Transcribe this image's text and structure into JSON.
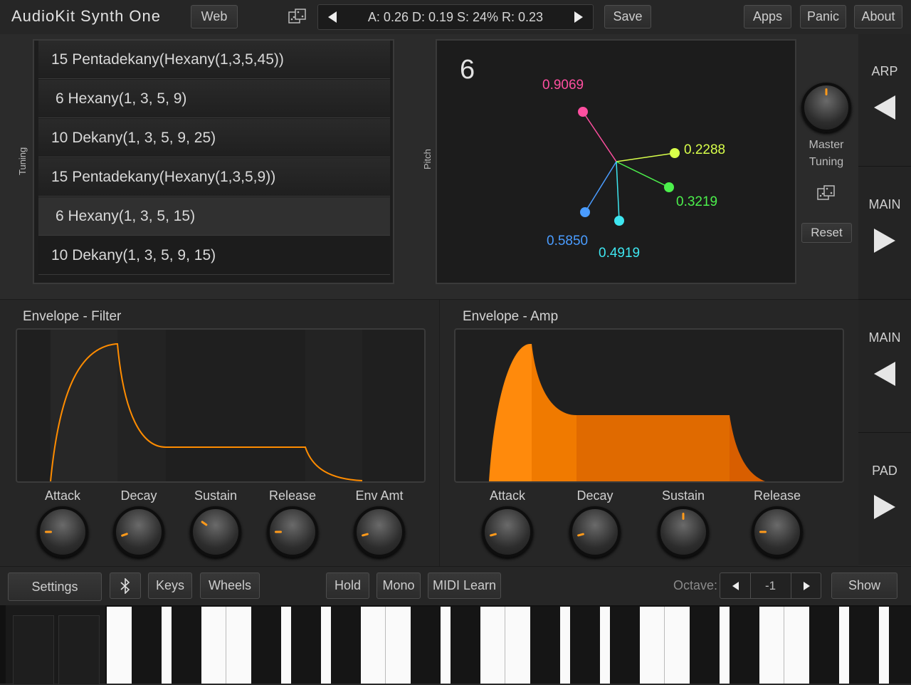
{
  "header": {
    "app_title": "AudioKit Synth One",
    "web_label": "Web",
    "dice_icon": "dice-icon",
    "preset_text": "A: 0.26 D: 0.19 S: 24% R: 0.23",
    "save_label": "Save",
    "apps_label": "Apps",
    "panic_label": "Panic",
    "about_label": "About"
  },
  "tuning_list": {
    "side_label": "Tuning",
    "items": [
      "15 Pentadekany(Hexany(1,3,5,45))",
      "6 Hexany(1, 3, 5, 9)",
      "10 Dekany(1, 3, 5, 9, 25)",
      "15 Pentadekany(Hexany(1,3,5,9))",
      "6 Hexany(1, 3, 5, 15)",
      "10 Dekany(1, 3, 5, 9, 15)"
    ],
    "selected_index": 4
  },
  "tuning_display": {
    "side_label": "Pitch",
    "count": "6",
    "values": [
      {
        "label": "0.9069",
        "color": "#ff4fa0"
      },
      {
        "label": "0.2288",
        "color": "#d8ff4a"
      },
      {
        "label": "0.3219",
        "color": "#4cf04c"
      },
      {
        "label": "0.5850",
        "color": "#4a9cff"
      },
      {
        "label": "0.4919",
        "color": "#3ee6f0"
      }
    ]
  },
  "master_tuning": {
    "label_line1": "Master",
    "label_line2": "Tuning",
    "reset_label": "Reset"
  },
  "side_nav": [
    {
      "label": "ARP",
      "arrow": "left"
    },
    {
      "label": "MAIN",
      "arrow": "right"
    },
    {
      "label": "MAIN",
      "arrow": "left"
    },
    {
      "label": "PAD",
      "arrow": "right"
    }
  ],
  "envelope_filter": {
    "title": "Envelope - Filter",
    "knobs": [
      "Attack",
      "Decay",
      "Sustain",
      "Release",
      "Env Amt"
    ],
    "accent": "#ff8c00"
  },
  "envelope_amp": {
    "title": "Envelope - Amp",
    "knobs": [
      "Attack",
      "Decay",
      "Sustain",
      "Release"
    ],
    "accent": "#f07800"
  },
  "bottom": {
    "settings_label": "Settings",
    "bluetooth_icon": "bluetooth-icon",
    "keys_label": "Keys",
    "wheels_label": "Wheels",
    "hold_label": "Hold",
    "mono_label": "Mono",
    "midi_learn_label": "MIDI Learn",
    "octave_label": "Octave:",
    "octave_value": "-1",
    "show_label": "Show"
  }
}
